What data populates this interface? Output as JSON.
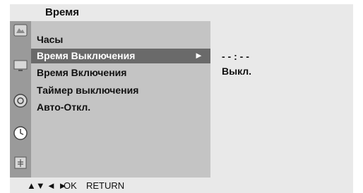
{
  "header": {
    "title": "Время"
  },
  "sidebar": {
    "icons": [
      "picture-icon",
      "screen-icon",
      "speaker-icon",
      "clock-icon",
      "lock-icon"
    ]
  },
  "menu": {
    "items": [
      {
        "label": "Часы"
      },
      {
        "label": "Время Выключения",
        "arrow": "►"
      },
      {
        "label": "Время Включения"
      },
      {
        "label": "Таймер выключения"
      },
      {
        "label": "Авто-Откл."
      }
    ]
  },
  "values": {
    "time": "- - : - -",
    "state": "Выкл."
  },
  "footer": {
    "updown": "▲▼",
    "leftright": "◄ ►",
    "ok": "OK",
    "return": "RETURN"
  }
}
